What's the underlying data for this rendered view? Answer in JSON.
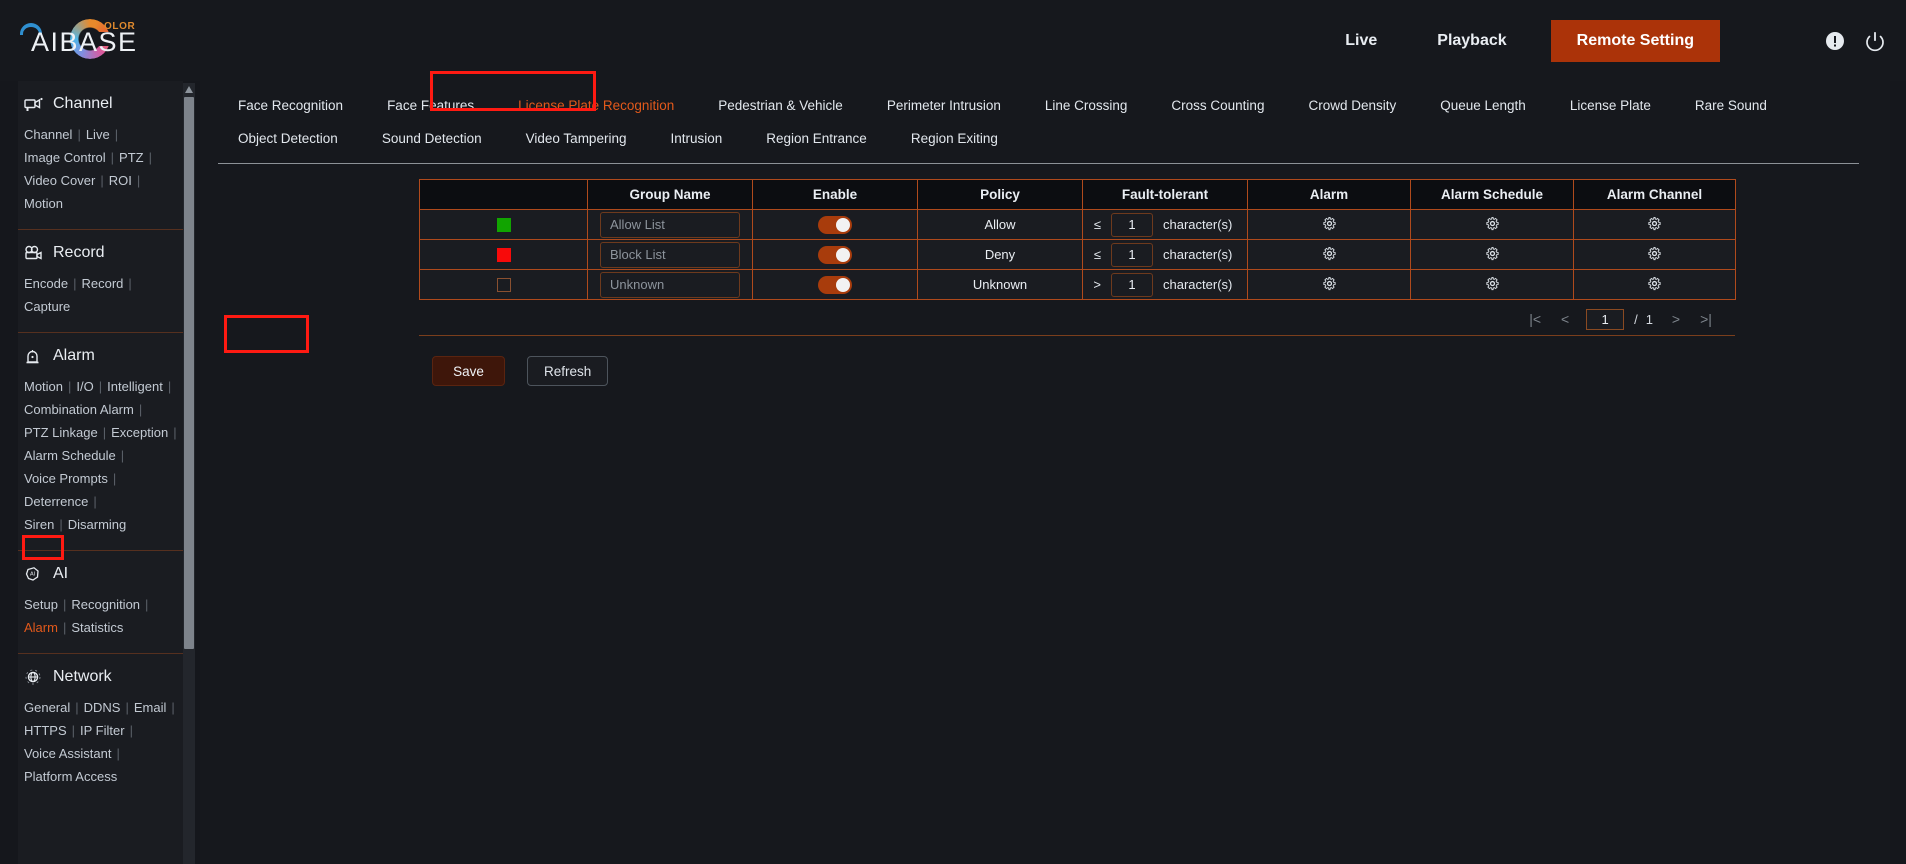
{
  "header": {
    "logo_text": "AIBASE",
    "logo_sub": "OLOR",
    "nav": [
      {
        "label": "Live",
        "name": "live"
      },
      {
        "label": "Playback",
        "name": "playback"
      }
    ],
    "remote_setting_label": "Remote Setting",
    "info_icon": "exclamation-circle-icon",
    "power_icon": "power-icon",
    "accent_color": "#ab3309"
  },
  "sidebar": {
    "sections": [
      {
        "title": "Channel",
        "icon": "camera-icon",
        "links": [
          "Channel",
          "Live",
          "Image Control",
          "PTZ",
          "Video Cover",
          "ROI",
          "Motion"
        ]
      },
      {
        "title": "Record",
        "icon": "video-camera-icon",
        "links": [
          "Encode",
          "Record",
          "Capture"
        ]
      },
      {
        "title": "Alarm",
        "icon": "alarm-light-icon",
        "links": [
          "Motion",
          "I/O",
          "Intelligent",
          "Combination Alarm",
          "PTZ Linkage",
          "Exception",
          "Alarm Schedule",
          "Voice Prompts",
          "Deterrence",
          "Siren",
          "Disarming"
        ]
      },
      {
        "title": "AI",
        "icon": "ai-head-icon",
        "links": [
          "Setup",
          "Recognition",
          "Alarm",
          "Statistics"
        ],
        "active_link": "Alarm"
      },
      {
        "title": "Network",
        "icon": "globe-icon",
        "links": [
          "General",
          "DDNS",
          "Email",
          "HTTPS",
          "IP Filter",
          "Voice Assistant",
          "Platform Access"
        ]
      }
    ]
  },
  "tabs": {
    "row1": [
      "Face Recognition",
      "Face Features",
      "License Plate Recognition",
      "Pedestrian & Vehicle",
      "Perimeter Intrusion",
      "Line Crossing",
      "Cross Counting",
      "Crowd Density",
      "Queue Length",
      "License Plate",
      "Rare Sound"
    ],
    "row2": [
      "Object Detection",
      "Sound Detection",
      "Video Tampering",
      "Intrusion",
      "Region Entrance",
      "Region Exiting"
    ],
    "active": "License Plate Recognition"
  },
  "table": {
    "headers": [
      "",
      "Group Name",
      "Enable",
      "Policy",
      "Fault-tolerant",
      "Alarm",
      "Alarm Schedule",
      "Alarm Channel"
    ],
    "rows": [
      {
        "swatch_color": "#11a400",
        "group_name": "Allow List",
        "enabled": true,
        "policy": "Allow",
        "ft_operator": "≤",
        "ft_value": "1",
        "ft_unit": "character(s)",
        "alarm_icon": "gear-icon",
        "alarm_schedule_icon": "gear-icon",
        "alarm_channel_icon": "gear-icon"
      },
      {
        "swatch_color": "#f80a0a",
        "group_name": "Block List",
        "enabled": true,
        "policy": "Deny",
        "ft_operator": "≤",
        "ft_value": "1",
        "ft_unit": "character(s)",
        "alarm_icon": "gear-icon",
        "alarm_schedule_icon": "gear-icon",
        "alarm_channel_icon": "gear-icon"
      },
      {
        "swatch_color": "",
        "group_name": "Unknown",
        "enabled": true,
        "policy": "Unknown",
        "ft_operator": ">",
        "ft_value": "1",
        "ft_unit": "character(s)",
        "alarm_icon": "gear-icon",
        "alarm_schedule_icon": "gear-icon",
        "alarm_channel_icon": "gear-icon"
      }
    ]
  },
  "pagination": {
    "first_icon": "first-page-icon",
    "prev_icon": "prev-page-icon",
    "current_page": "1",
    "separator": "/",
    "total_pages": "1",
    "next_icon": "next-page-icon",
    "last_icon": "last-page-icon"
  },
  "buttons": {
    "save": "Save",
    "refresh": "Refresh"
  }
}
